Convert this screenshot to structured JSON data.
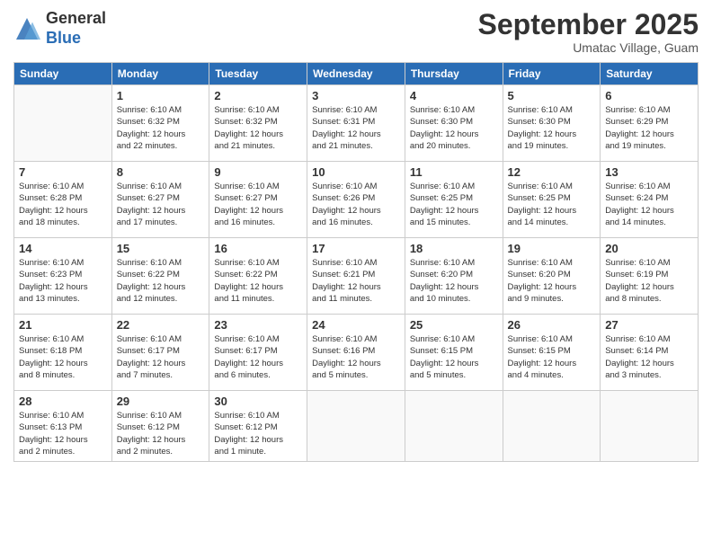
{
  "header": {
    "logo_general": "General",
    "logo_blue": "Blue",
    "month_title": "September 2025",
    "subtitle": "Umatac Village, Guam"
  },
  "weekdays": [
    "Sunday",
    "Monday",
    "Tuesday",
    "Wednesday",
    "Thursday",
    "Friday",
    "Saturday"
  ],
  "weeks": [
    [
      {
        "day": "",
        "info": ""
      },
      {
        "day": "1",
        "info": "Sunrise: 6:10 AM\nSunset: 6:32 PM\nDaylight: 12 hours\nand 22 minutes."
      },
      {
        "day": "2",
        "info": "Sunrise: 6:10 AM\nSunset: 6:32 PM\nDaylight: 12 hours\nand 21 minutes."
      },
      {
        "day": "3",
        "info": "Sunrise: 6:10 AM\nSunset: 6:31 PM\nDaylight: 12 hours\nand 21 minutes."
      },
      {
        "day": "4",
        "info": "Sunrise: 6:10 AM\nSunset: 6:30 PM\nDaylight: 12 hours\nand 20 minutes."
      },
      {
        "day": "5",
        "info": "Sunrise: 6:10 AM\nSunset: 6:30 PM\nDaylight: 12 hours\nand 19 minutes."
      },
      {
        "day": "6",
        "info": "Sunrise: 6:10 AM\nSunset: 6:29 PM\nDaylight: 12 hours\nand 19 minutes."
      }
    ],
    [
      {
        "day": "7",
        "info": "Sunrise: 6:10 AM\nSunset: 6:28 PM\nDaylight: 12 hours\nand 18 minutes."
      },
      {
        "day": "8",
        "info": "Sunrise: 6:10 AM\nSunset: 6:27 PM\nDaylight: 12 hours\nand 17 minutes."
      },
      {
        "day": "9",
        "info": "Sunrise: 6:10 AM\nSunset: 6:27 PM\nDaylight: 12 hours\nand 16 minutes."
      },
      {
        "day": "10",
        "info": "Sunrise: 6:10 AM\nSunset: 6:26 PM\nDaylight: 12 hours\nand 16 minutes."
      },
      {
        "day": "11",
        "info": "Sunrise: 6:10 AM\nSunset: 6:25 PM\nDaylight: 12 hours\nand 15 minutes."
      },
      {
        "day": "12",
        "info": "Sunrise: 6:10 AM\nSunset: 6:25 PM\nDaylight: 12 hours\nand 14 minutes."
      },
      {
        "day": "13",
        "info": "Sunrise: 6:10 AM\nSunset: 6:24 PM\nDaylight: 12 hours\nand 14 minutes."
      }
    ],
    [
      {
        "day": "14",
        "info": "Sunrise: 6:10 AM\nSunset: 6:23 PM\nDaylight: 12 hours\nand 13 minutes."
      },
      {
        "day": "15",
        "info": "Sunrise: 6:10 AM\nSunset: 6:22 PM\nDaylight: 12 hours\nand 12 minutes."
      },
      {
        "day": "16",
        "info": "Sunrise: 6:10 AM\nSunset: 6:22 PM\nDaylight: 12 hours\nand 11 minutes."
      },
      {
        "day": "17",
        "info": "Sunrise: 6:10 AM\nSunset: 6:21 PM\nDaylight: 12 hours\nand 11 minutes."
      },
      {
        "day": "18",
        "info": "Sunrise: 6:10 AM\nSunset: 6:20 PM\nDaylight: 12 hours\nand 10 minutes."
      },
      {
        "day": "19",
        "info": "Sunrise: 6:10 AM\nSunset: 6:20 PM\nDaylight: 12 hours\nand 9 minutes."
      },
      {
        "day": "20",
        "info": "Sunrise: 6:10 AM\nSunset: 6:19 PM\nDaylight: 12 hours\nand 8 minutes."
      }
    ],
    [
      {
        "day": "21",
        "info": "Sunrise: 6:10 AM\nSunset: 6:18 PM\nDaylight: 12 hours\nand 8 minutes."
      },
      {
        "day": "22",
        "info": "Sunrise: 6:10 AM\nSunset: 6:17 PM\nDaylight: 12 hours\nand 7 minutes."
      },
      {
        "day": "23",
        "info": "Sunrise: 6:10 AM\nSunset: 6:17 PM\nDaylight: 12 hours\nand 6 minutes."
      },
      {
        "day": "24",
        "info": "Sunrise: 6:10 AM\nSunset: 6:16 PM\nDaylight: 12 hours\nand 5 minutes."
      },
      {
        "day": "25",
        "info": "Sunrise: 6:10 AM\nSunset: 6:15 PM\nDaylight: 12 hours\nand 5 minutes."
      },
      {
        "day": "26",
        "info": "Sunrise: 6:10 AM\nSunset: 6:15 PM\nDaylight: 12 hours\nand 4 minutes."
      },
      {
        "day": "27",
        "info": "Sunrise: 6:10 AM\nSunset: 6:14 PM\nDaylight: 12 hours\nand 3 minutes."
      }
    ],
    [
      {
        "day": "28",
        "info": "Sunrise: 6:10 AM\nSunset: 6:13 PM\nDaylight: 12 hours\nand 2 minutes."
      },
      {
        "day": "29",
        "info": "Sunrise: 6:10 AM\nSunset: 6:12 PM\nDaylight: 12 hours\nand 2 minutes."
      },
      {
        "day": "30",
        "info": "Sunrise: 6:10 AM\nSunset: 6:12 PM\nDaylight: 12 hours\nand 1 minute."
      },
      {
        "day": "",
        "info": ""
      },
      {
        "day": "",
        "info": ""
      },
      {
        "day": "",
        "info": ""
      },
      {
        "day": "",
        "info": ""
      }
    ]
  ]
}
